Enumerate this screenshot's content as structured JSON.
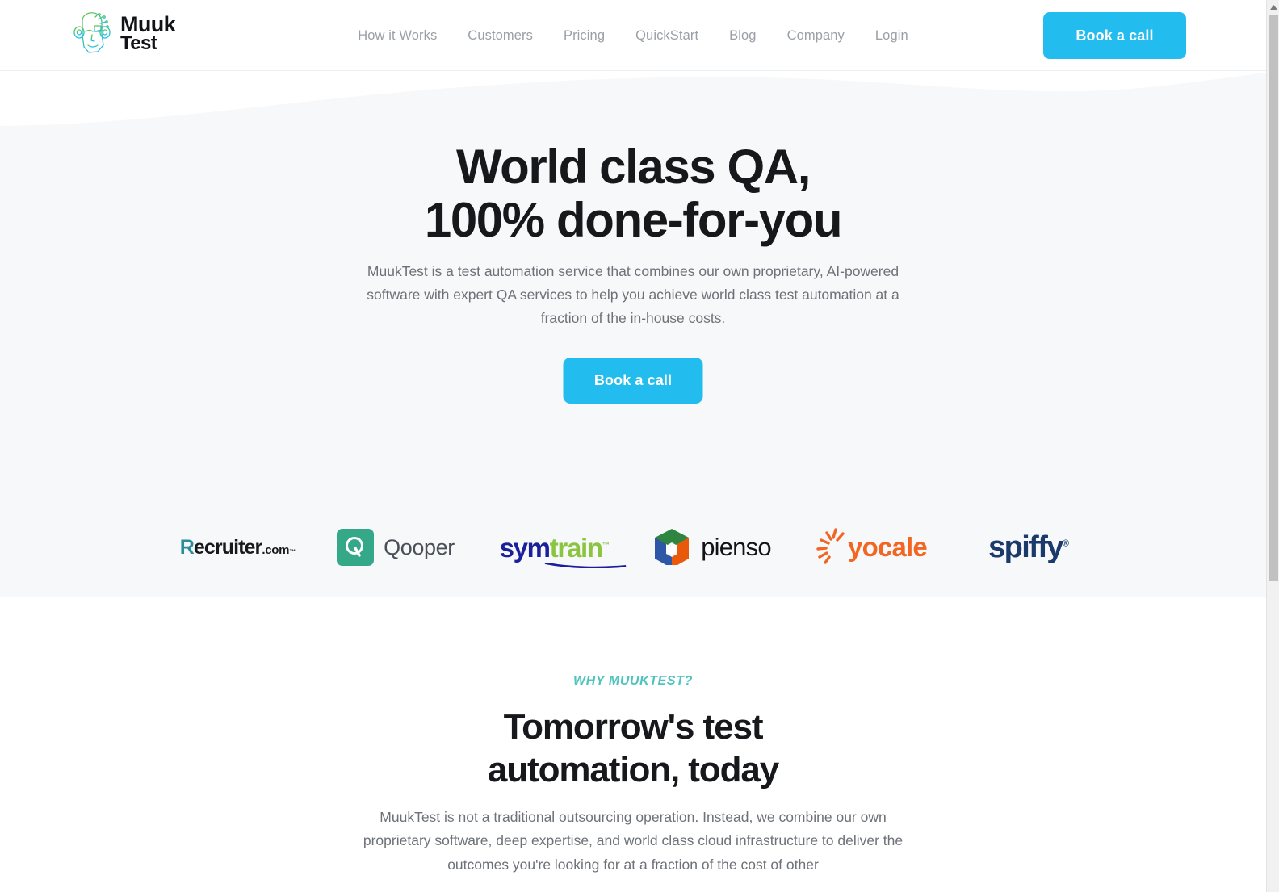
{
  "brand": {
    "name_line1": "Muuk",
    "name_line2": "Test",
    "logo_icon": "face-line-art-icon",
    "gradient_top": "#6cc24a",
    "gradient_bottom": "#22bcee"
  },
  "nav": {
    "items": [
      {
        "label": "How it Works"
      },
      {
        "label": "Customers"
      },
      {
        "label": "Pricing"
      },
      {
        "label": "QuickStart"
      },
      {
        "label": "Blog"
      },
      {
        "label": "Company"
      },
      {
        "label": "Login"
      }
    ],
    "cta_label": "Book a call",
    "cta_color": "#22bcee",
    "link_color": "#9aa0a6"
  },
  "hero": {
    "title": "World class QA,\n100% done-for-you",
    "subtitle": "MuukTest is a test automation service that combines our own proprietary, AI-powered software with expert QA services to help you achieve world class test automation at a fraction of the in-house costs.",
    "cta_label": "Book a call",
    "background": "#f6f8fa"
  },
  "logos": {
    "items": [
      {
        "name": "Recruiter.com",
        "word": "ecruiter",
        "initial": "R",
        "suffix": ".com",
        "trademark": "™",
        "color": "#18191b",
        "accent": "#2b8c9c"
      },
      {
        "name": "Qooper",
        "word": "Qooper",
        "mark_letter": "Q",
        "color": "#4b5056",
        "accent": "#35a88a"
      },
      {
        "name": "symtrain",
        "part1": "sym",
        "part2": "train",
        "trademark": "™",
        "color": "#1a1f9c",
        "accent": "#8bc53f"
      },
      {
        "name": "pienso",
        "word": "pienso",
        "color": "#111316",
        "accent_green": "#2e8540",
        "accent_blue": "#2e58a6",
        "accent_orange": "#e8590c"
      },
      {
        "name": "yocale",
        "word": "ocale",
        "initial": "y",
        "color": "#f26522"
      },
      {
        "name": "spiffy",
        "word": "spiffy",
        "registered": "®",
        "color": "#1b3a6b"
      }
    ]
  },
  "why": {
    "eyebrow": "WHY MUUKTEST?",
    "eyebrow_color": "#4fc3be",
    "title": "Tomorrow's test\nautomation, today",
    "body": "MuukTest is not a traditional outsourcing operation. Instead, we combine our own proprietary software, deep expertise, and world class cloud infrastructure to deliver the outcomes you're looking for at a fraction of the cost of other"
  }
}
